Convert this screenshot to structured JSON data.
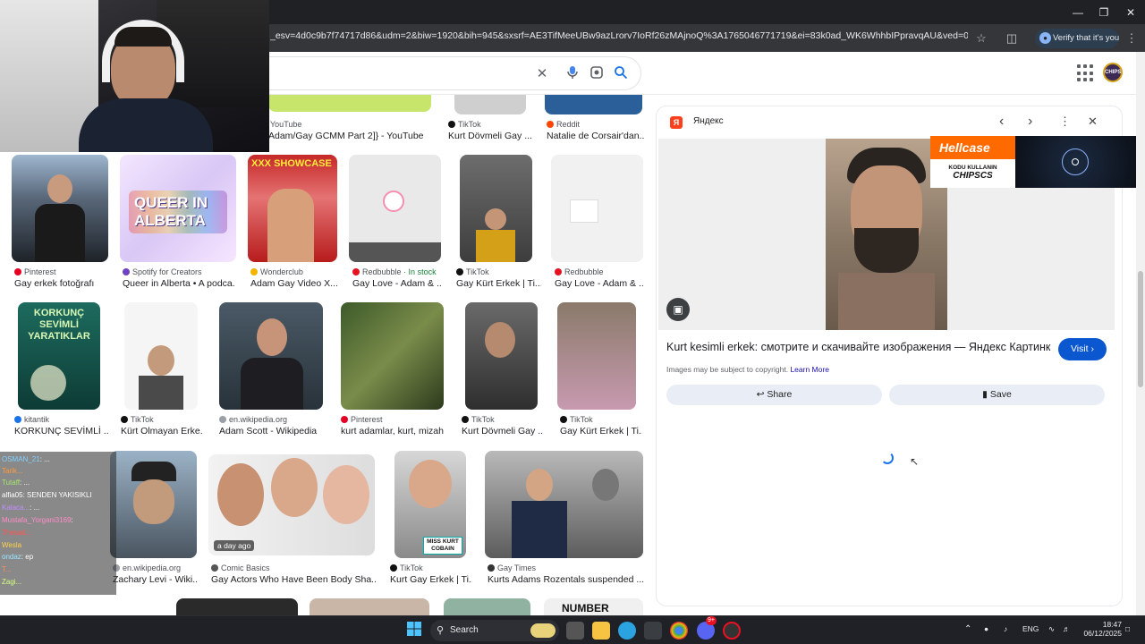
{
  "browser": {
    "url": "_esv=4d0c9b7f74717d86&udm=2&biw=1920&bih=945&sxsrf=AE3TifMeeUBw9azLrorv7IoRf26zMAjnoQ%3A1765046771719&ei=83k0ad_WK6WhhbIPpravqAU&ved=0ahUKEwifnNzOz6mR...",
    "verify_label": "Verify that it's you",
    "window_controls": [
      "minimize-icon",
      "maximize-icon",
      "close-icon"
    ]
  },
  "search": {
    "icons": [
      "clear-icon",
      "microphone-icon",
      "lens-icon",
      "search-icon"
    ]
  },
  "results": {
    "row0": [
      {
        "source": "YouTube",
        "caption": "Adam/Gay GCMM Part 2]} - YouTube"
      },
      {
        "source": "TikTok",
        "caption": "Kurt Dövmeli Gay ..."
      },
      {
        "source": "Reddit",
        "caption": "Natalie de Corsair'dan..."
      }
    ],
    "row1": [
      {
        "source": "Pinterest",
        "caption": "Gay erkek fotoğrafı",
        "color": "#e60023"
      },
      {
        "source": "Spotify for Creators",
        "caption": "Queer in Alberta • A podca...",
        "color": "#6f42c1"
      },
      {
        "source": "Wonderclub",
        "caption": "Adam Gay Video X...",
        "color": "#f4b400"
      },
      {
        "source": "Redbubble",
        "extra": "· In stock",
        "caption": "Gay Love - Adam & ...",
        "color": "#e41321"
      },
      {
        "source": "TikTok",
        "caption": "Gay Kürt Erkek | Ti...",
        "color": "#111111"
      },
      {
        "source": "Redbubble",
        "caption": "Gay Love - Adam & ...",
        "color": "#e41321"
      }
    ],
    "row2": [
      {
        "source": "kitantik",
        "caption": "KORKUNÇ SEVİMLİ ...",
        "color": "#1a73e8"
      },
      {
        "source": "TikTok",
        "caption": "Kürt Olmayan Erke...",
        "color": "#111111"
      },
      {
        "source": "en.wikipedia.org",
        "caption": "Adam Scott - Wikipedia",
        "color": "#5f6368"
      },
      {
        "source": "Pinterest",
        "caption": "kurt adamlar, kurt, mizah",
        "color": "#e60023"
      },
      {
        "source": "TikTok",
        "caption": "Kurt Dövmeli Gay ...",
        "color": "#111111"
      },
      {
        "source": "TikTok",
        "caption": "Gay Kürt Erkek | Ti...",
        "color": "#111111"
      }
    ],
    "row3": [
      {
        "source": "en.wikipedia.org",
        "caption": "Zachary Levi - Wiki...",
        "color": "#5f6368"
      },
      {
        "source": "Comic Basics",
        "caption": "Gay Actors Who Have Been Body Sha...",
        "color": "#555555"
      },
      {
        "source": "TikTok",
        "caption": "Kurt Gay Erkek | Ti...",
        "color": "#111111"
      },
      {
        "source": "Gay Times",
        "caption": "Kurts Adams Rozentals suspended ...",
        "color": "#333333"
      }
    ],
    "thumb_texts": {
      "queer": "QUEER IN ALBERTA",
      "showcase": "XXX SHOWCASE",
      "korkunc": "KORKUNÇ SEVİMLİ YARATIKLAR",
      "miss_kurt": "MISS KURT COBAIN",
      "age": "a day ago",
      "number": "NUMBER"
    }
  },
  "panel": {
    "site": "Яндекс",
    "title": "Kurt kesimli erkek: смотрите и скачивайте изображения — Яндекс Картинки",
    "visit": "Visit",
    "copyright": "Images may be subject to copyright.",
    "learn_more": "Learn More",
    "share": "Share",
    "save": "Save"
  },
  "overlay": {
    "hellcase": "Hellcase",
    "hellcase_sub1": "KODU KULLANIN",
    "hellcase_sub2": "CHIPSCS"
  },
  "chat": [
    {
      "user": "OSMAN_21",
      "msg": ": ...",
      "color": "#7fd1ff"
    },
    {
      "user": "Tarik...",
      "msg": "",
      "color": "#ff9a3c"
    },
    {
      "user": "Tutaff",
      "msg": ": ...",
      "color": "#a6e36e"
    },
    {
      "user": "alfia05",
      "msg": ": SENDEN YAKISIKLI",
      "color": "#ffffff"
    },
    {
      "user": "Kalaca...",
      "msg": ": ...",
      "color": "#c58cff"
    },
    {
      "user": "Mustafa_Yorgani3169",
      "msg": ":",
      "color": "#ff8cc8"
    },
    {
      "user": "Thesad...",
      "msg": "",
      "color": "#ff5555"
    },
    {
      "user": "Wesla",
      "msg": "",
      "color": "#ffd24a"
    },
    {
      "user": "ondaz",
      "msg": ": ep",
      "color": "#9ae6ff"
    },
    {
      "user": "T...",
      "msg": "",
      "color": "#ff8c5a"
    },
    {
      "user": "Zagi...",
      "msg": "",
      "color": "#d3ff7a"
    }
  ],
  "taskbar": {
    "search": "Search",
    "lang": "ENG",
    "time": "18:47",
    "date": "06/12/2025",
    "notif": "9+"
  }
}
